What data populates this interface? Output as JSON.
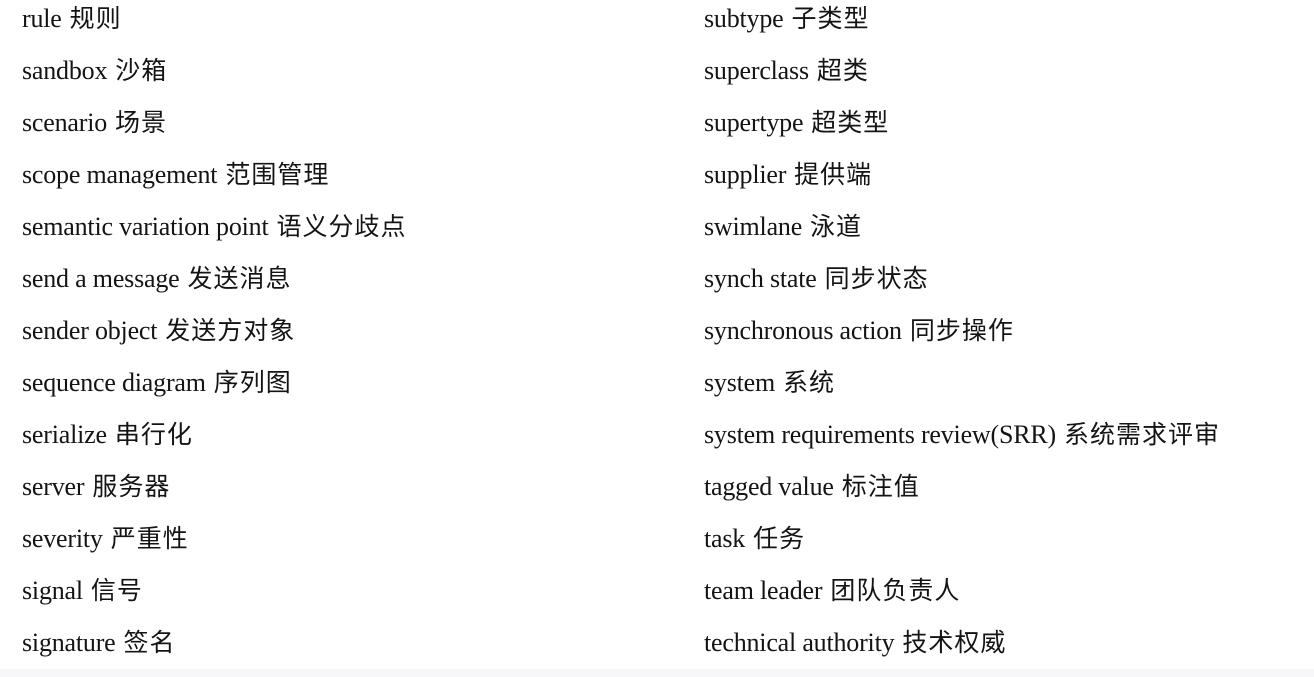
{
  "glossary": {
    "left": [
      {
        "term": "rule",
        "translation": "规则"
      },
      {
        "term": "sandbox",
        "translation": "沙箱"
      },
      {
        "term": "scenario",
        "translation": "场景"
      },
      {
        "term": "scope management",
        "translation": "范围管理"
      },
      {
        "term": "semantic variation point",
        "translation": "语义分歧点"
      },
      {
        "term": "send a message",
        "translation": "发送消息"
      },
      {
        "term": "sender object",
        "translation": "发送方对象"
      },
      {
        "term": "sequence diagram",
        "translation": "序列图"
      },
      {
        "term": "serialize",
        "translation": "串行化"
      },
      {
        "term": "server",
        "translation": "服务器"
      },
      {
        "term": "severity",
        "translation": "严重性"
      },
      {
        "term": "signal",
        "translation": "信号"
      },
      {
        "term": "signature",
        "translation": "签名"
      }
    ],
    "right": [
      {
        "term": "subtype",
        "translation": "子类型"
      },
      {
        "term": "superclass",
        "translation": "超类"
      },
      {
        "term": "supertype",
        "translation": "超类型"
      },
      {
        "term": "supplier",
        "translation": "提供端"
      },
      {
        "term": "swimlane",
        "translation": "泳道"
      },
      {
        "term": "synch state",
        "translation": "同步状态"
      },
      {
        "term": "synchronous action",
        "translation": "同步操作"
      },
      {
        "term": "system",
        "translation": "系统"
      },
      {
        "term": "system requirements review(SRR)",
        "translation": "系统需求评审"
      },
      {
        "term": "tagged value",
        "translation": "标注值"
      },
      {
        "term": "task",
        "translation": "任务"
      },
      {
        "term": "team leader",
        "translation": "团队负责人"
      },
      {
        "term": "technical authority",
        "translation": "技术权威"
      }
    ]
  }
}
